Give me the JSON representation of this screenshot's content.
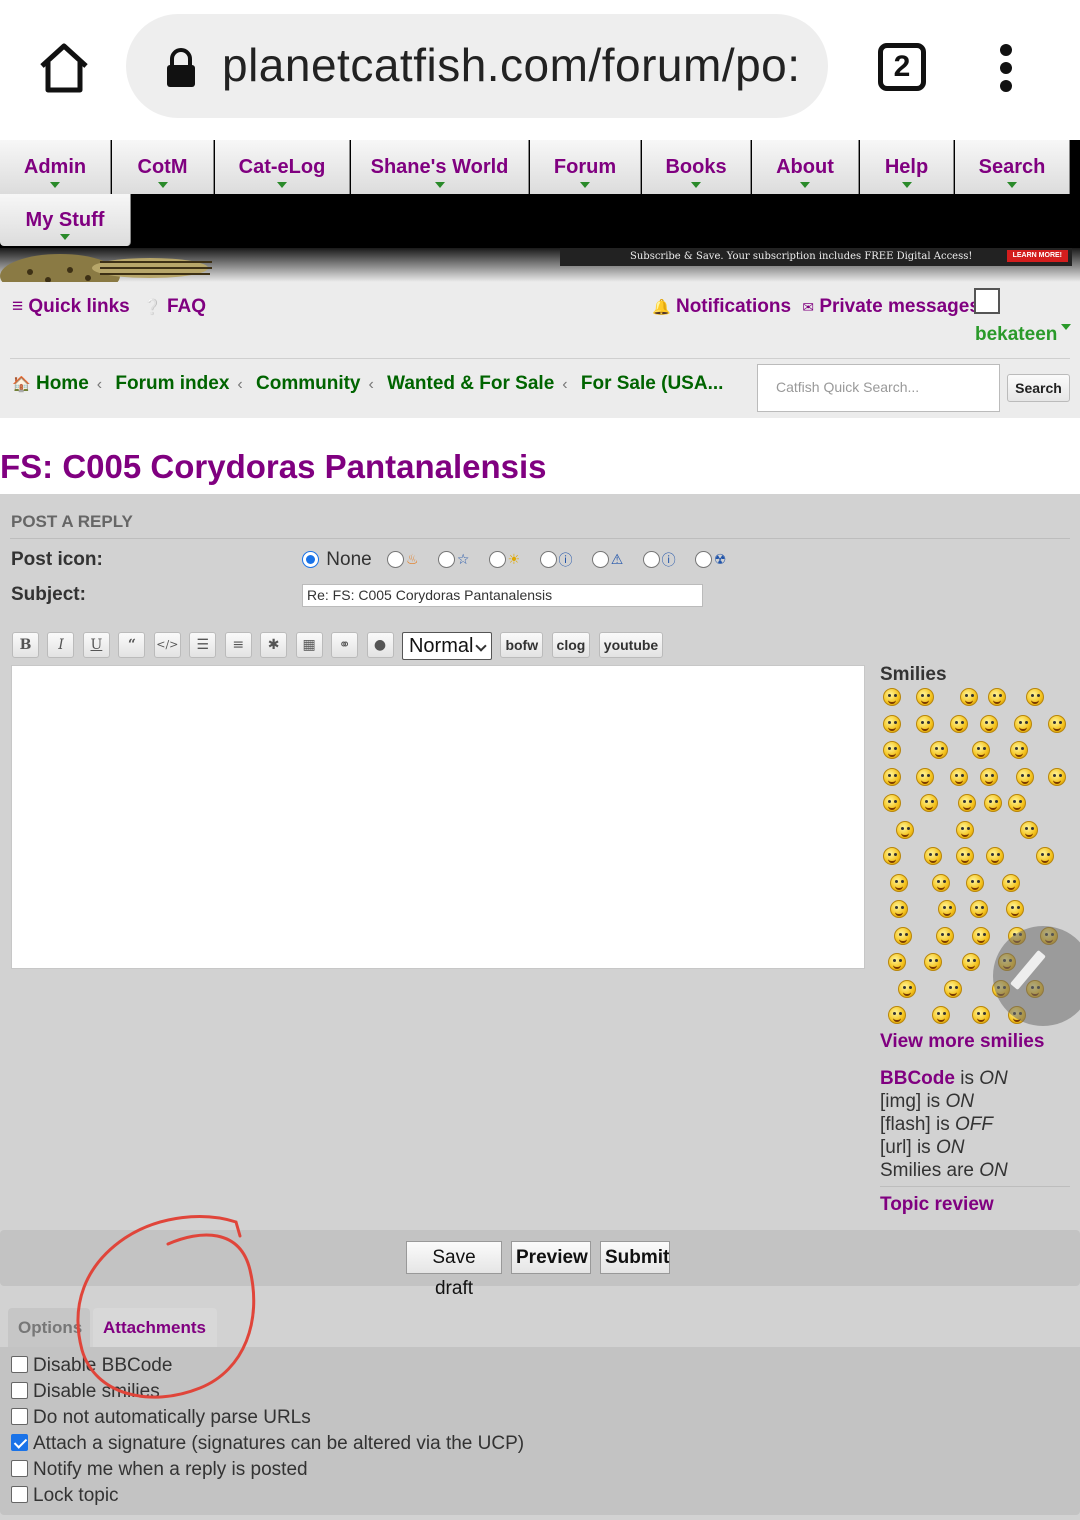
{
  "browser": {
    "url": "planetcatfish.com/forum/po:",
    "tab_count": "2"
  },
  "nav": {
    "items": [
      "Admin",
      "CotM",
      "Cat-eLog",
      "Shane's World",
      "Forum",
      "Books",
      "About",
      "Help",
      "Search"
    ],
    "my_stuff": "My Stuff"
  },
  "banner": {
    "promo": "Subscribe & Save. Your subscription includes FREE Digital Access!",
    "learn_more": "LEARN MORE!"
  },
  "header": {
    "quick_links": "Quick links",
    "faq": "FAQ",
    "notifications": "Notifications",
    "private_messages": "Private messages",
    "username": "bekateen",
    "breadcrumbs": [
      "Home",
      "Forum index",
      "Community",
      "Wanted & For Sale",
      "For Sale (USA..."
    ],
    "search_placeholder": "Catfish Quick Search...",
    "search_button": "Search"
  },
  "page": {
    "title": "FS: C005 Corydoras Pantanalensis"
  },
  "post": {
    "section_title": "POST A REPLY",
    "post_icon_label": "Post icon:",
    "post_icon_none": "None",
    "subject_label": "Subject:",
    "subject_value": "Re: FS: C005 Corydoras Pantanalensis",
    "font_size_selected": "Normal",
    "custom_buttons": [
      "bofw",
      "clog",
      "youtube"
    ]
  },
  "smilies": {
    "title": "Smilies",
    "view_more": "View more smilies"
  },
  "bbcode_info": {
    "bbcode_link": "BBCode",
    "bbcode_is": "is",
    "bbcode_state": "ON",
    "img_label": "[img] is",
    "img_state": "ON",
    "flash_label": "[flash] is",
    "flash_state": "OFF",
    "url_label": "[url] is",
    "url_state": "ON",
    "smilies_label": "Smilies are",
    "smilies_state": "ON",
    "topic_review": "Topic review"
  },
  "actions": {
    "save_draft": "Save draft",
    "preview": "Preview",
    "submit": "Submit"
  },
  "tabs": {
    "options": "Options",
    "attachments": "Attachments"
  },
  "options": [
    {
      "label": "Disable BBCode",
      "checked": false
    },
    {
      "label": "Disable smilies",
      "checked": false
    },
    {
      "label": "Do not automatically parse URLs",
      "checked": false
    },
    {
      "label": "Attach a signature (signatures can be altered via the UCP)",
      "checked": true
    },
    {
      "label": "Notify me when a reply is posted",
      "checked": false
    },
    {
      "label": "Lock topic",
      "checked": false
    }
  ],
  "colors": {
    "link_purple": "#800080",
    "breadcrumb_green": "#006400",
    "user_green": "#2a9a2a",
    "annotation_red": "#e0453a"
  }
}
